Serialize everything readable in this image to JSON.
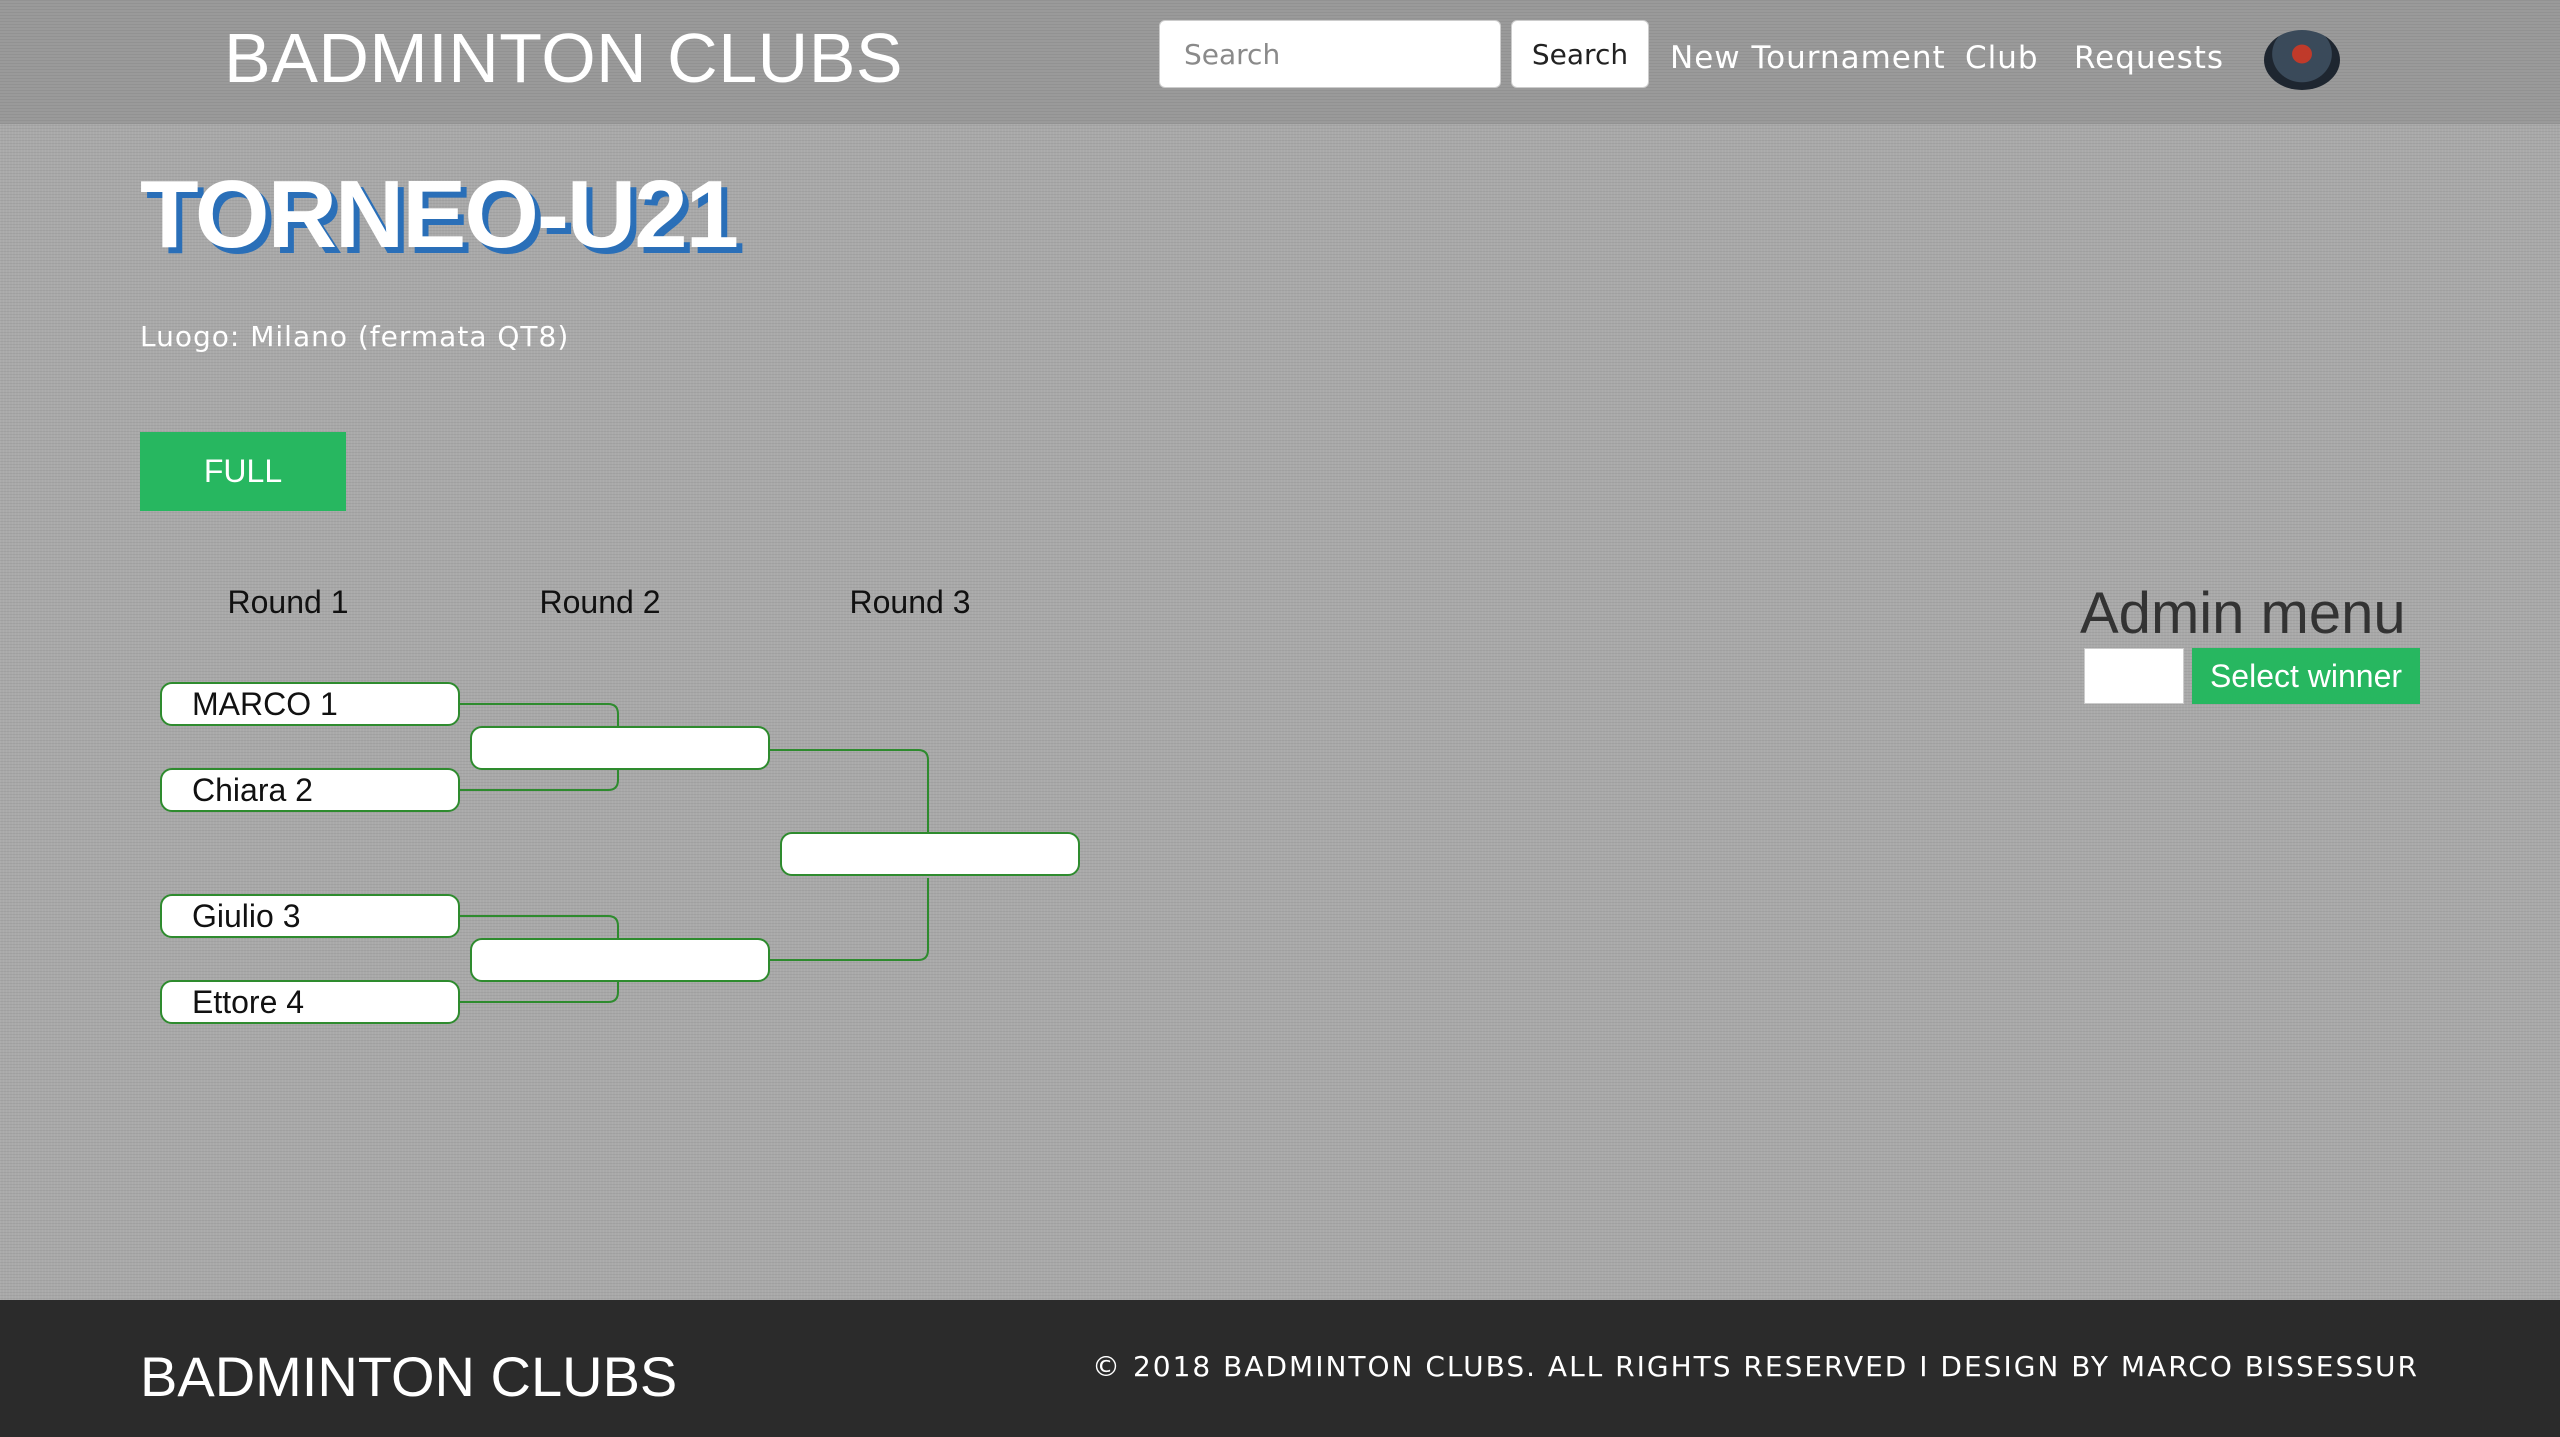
{
  "header": {
    "brand": "BADMINTON CLUBS",
    "search_placeholder": "Search",
    "search_value": "",
    "search_button": "Search",
    "nav": [
      "New Tournament",
      "Club",
      "Requests"
    ]
  },
  "tournament": {
    "title": "TORNEO-U21",
    "location": "Luogo: Milano (fermata QT8)",
    "status": "FULL"
  },
  "bracket": {
    "rounds": [
      "Round 1",
      "Round 2",
      "Round 3"
    ],
    "round1": [
      "MARCO 1",
      "Chiara 2",
      "Giulio 3",
      "Ettore 4"
    ],
    "round2": [
      "",
      ""
    ],
    "round3": [
      ""
    ]
  },
  "admin": {
    "title": "Admin menu",
    "input_value": "",
    "button": "Select winner"
  },
  "footer": {
    "brand": "BADMINTON CLUBS",
    "copyright": "© 2018 BADMINTON CLUBS. ALL RIGHTS RESERVED I DESIGN BY MARCO BISSESSUR"
  },
  "colors": {
    "accent_green": "#27b760",
    "title_shadow_blue": "#2a6fb8",
    "bracket_border": "#2e8b2e",
    "footer_bg": "#2b2b2b"
  }
}
